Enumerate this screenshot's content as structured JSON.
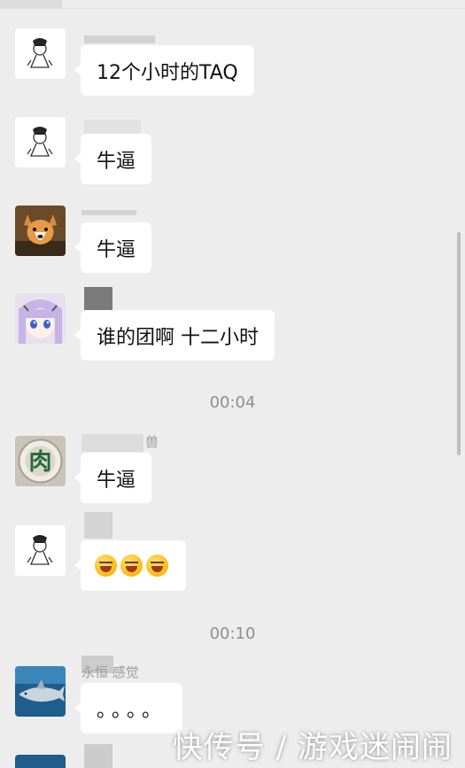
{
  "timestamps": [
    "00:04",
    "00:10"
  ],
  "messages": [
    {
      "avatar": "cartoon-boy-avatar",
      "nickname": "",
      "text": "12个小时的TAQ"
    },
    {
      "avatar": "cartoon-boy-avatar",
      "nickname": "",
      "text": "牛逼"
    },
    {
      "avatar": "corgi-dog-avatar",
      "nickname": "",
      "text": "牛逼"
    },
    {
      "avatar": "anime-girl-avatar",
      "nickname": "",
      "text": "谁的团啊  十二小时"
    },
    {
      "avatar": "bowl-meat-avatar",
      "nickname": "兽",
      "text": "牛逼"
    },
    {
      "avatar": "cartoon-boy-avatar",
      "nickname": "",
      "emoji_count": 3,
      "emoji": "grinning-sweat-emoji"
    },
    {
      "avatar": "shark-avatar",
      "nickname": "永恒 感觉",
      "text": "。。。。"
    }
  ],
  "watermark": "快传号 / 游戏迷闹闹",
  "colors": {
    "background": "#ededed",
    "bubble": "#ffffff",
    "timestamp": "#8e8e8e"
  }
}
